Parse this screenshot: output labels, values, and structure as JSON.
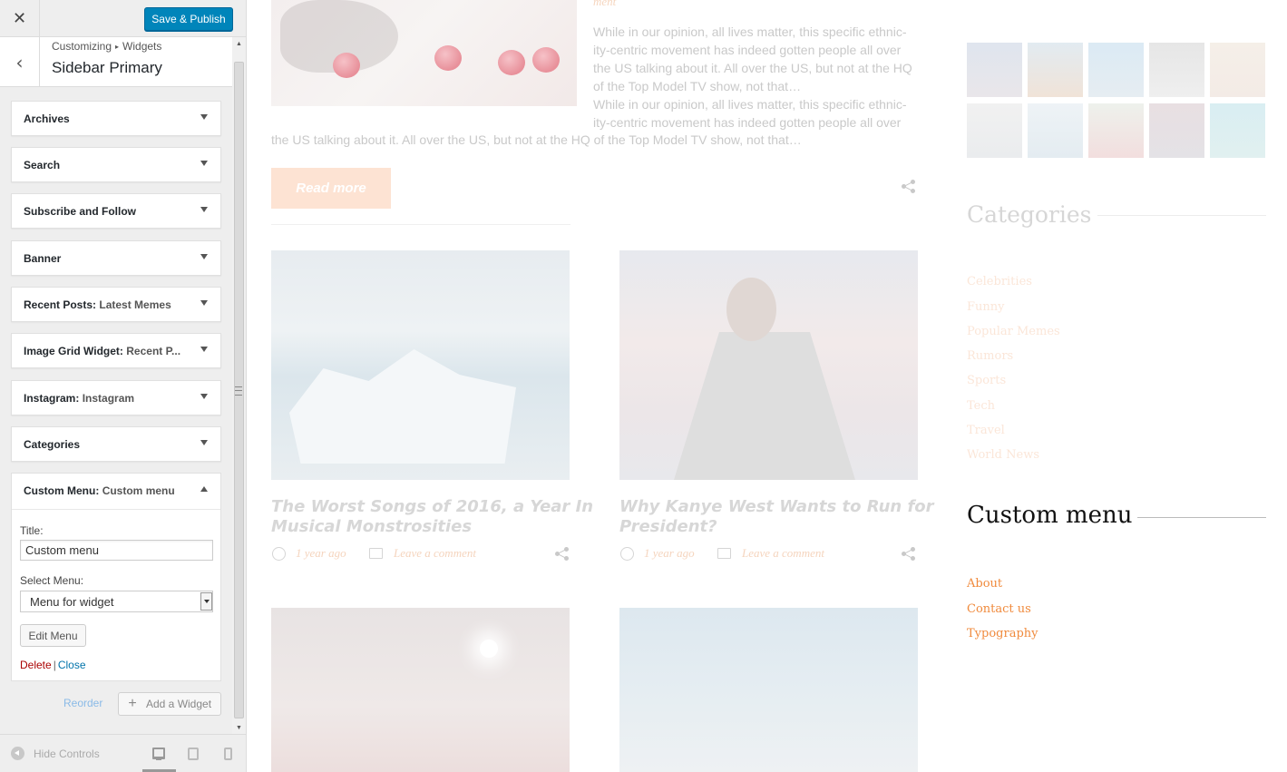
{
  "customizer": {
    "close_icon": "close-icon",
    "publish_label": "Save & Publish",
    "breadcrumb": [
      "Customizing",
      "Widgets"
    ],
    "section_title": "Sidebar Primary",
    "widgets": [
      {
        "title": "Archives",
        "subtitle": ""
      },
      {
        "title": "Search",
        "subtitle": ""
      },
      {
        "title": "Subscribe and Follow",
        "subtitle": ""
      },
      {
        "title": "Banner",
        "subtitle": ""
      },
      {
        "title": "Recent Posts",
        "subtitle": "Latest Memes"
      },
      {
        "title": "Image Grid Widget",
        "subtitle": "Recent P..."
      },
      {
        "title": "Instagram",
        "subtitle": "Instagram"
      },
      {
        "title": "Categories",
        "subtitle": ""
      }
    ],
    "open_widget": {
      "title": "Custom Menu",
      "subtitle": "Custom menu",
      "title_label": "Title:",
      "title_value": "Custom menu",
      "select_label": "Select Menu:",
      "select_value": "Menu for widget",
      "edit_menu_label": "Edit Menu",
      "delete_label": "Delete",
      "close_label": "Close"
    },
    "reorder_label": "Reorder",
    "add_widget_label": "Add a Widget",
    "hide_controls_label": "Hide Controls"
  },
  "preview": {
    "top_snippet": "ment",
    "excerpt_lines": [
      "While in our opinion, all lives matter, this specific ethnic-",
      "ity-centric movement has indeed gotten people all over",
      "the US talking about it. All over the US, but not at the HQ",
      "of the Top Model TV show, not that…",
      "While in our opinion, all lives matter, this specific ethnic-",
      "ity-centric movement has indeed gotten people all over"
    ],
    "excerpt_full_line": "the US talking about it. All over the US, but not at the HQ of the Top Model TV show, not that…",
    "read_more": "Read more",
    "posts": [
      {
        "title_lines": [
          "The Worst Songs of 2016, a Year In",
          "Musical Monstrosities"
        ],
        "time": "1 year ago",
        "comments": "Leave a comment"
      },
      {
        "title_lines": [
          "Why Kanye West Wants to Run for",
          "President?"
        ],
        "time": "1 year ago",
        "comments": "Leave a comment"
      }
    ],
    "sidebar": {
      "categories_heading": "Categories",
      "categories": [
        "Celebrities",
        "Funny",
        "Popular Memes",
        "Rumors",
        "Sports",
        "Tech",
        "Travel",
        "World News"
      ],
      "custom_menu_heading": "Custom menu",
      "custom_menu_items": [
        "About",
        "Contact us",
        "Typography"
      ]
    }
  },
  "colors": {
    "publish_blue": "#0085ba",
    "link_orange": "#f08a3c",
    "delete_red": "#aa0000",
    "close_blue": "#0073aa"
  }
}
